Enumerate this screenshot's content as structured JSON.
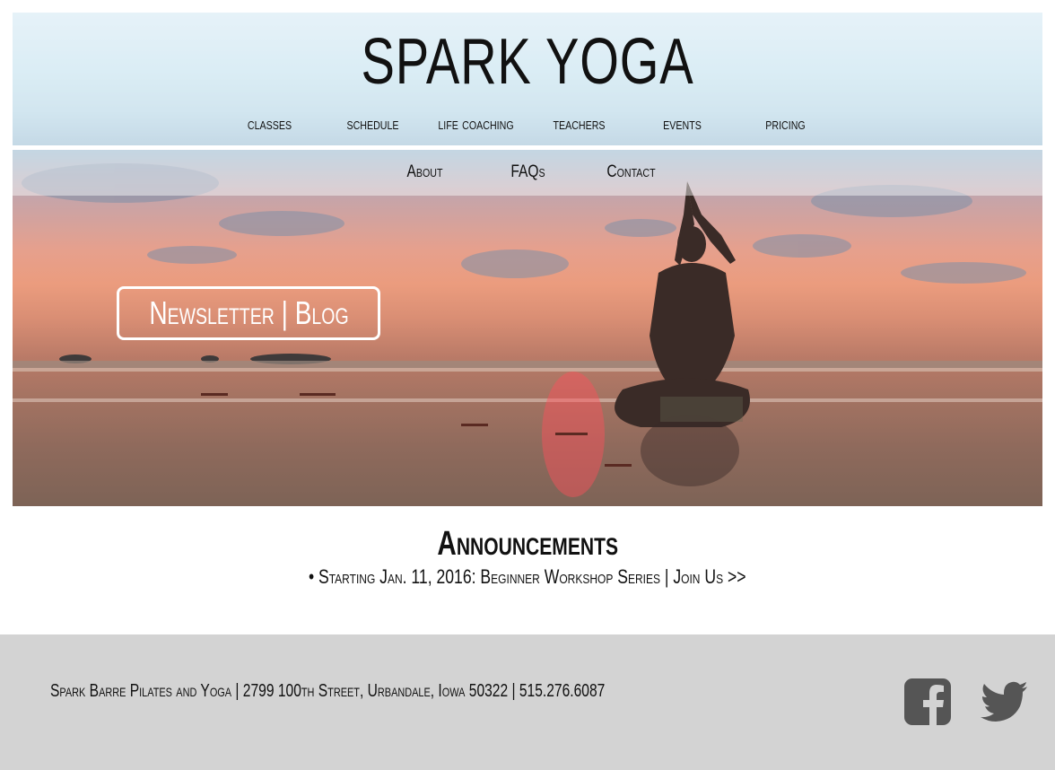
{
  "site": {
    "logo": "SPARK YOGA"
  },
  "nav": {
    "primary": [
      "classes",
      "schedule",
      "life coaching",
      "teachers",
      "events",
      "pricing"
    ],
    "secondary": [
      "About",
      "FAQs",
      "Contact"
    ]
  },
  "hero": {
    "cta_label": "Newsletter | Blog"
  },
  "announcements": {
    "title": "Announcements",
    "item": "• Starting Jan. 11, 2016: Beginner Workshop Series | Join Us >>"
  },
  "footer": {
    "info": "Spark Barre Pilates and Yoga | 2799 100th Street, Urbandale, Iowa 50322 | 515.276.6087",
    "icons": [
      "facebook-icon",
      "twitter-icon"
    ],
    "icon_color": "#555555"
  }
}
